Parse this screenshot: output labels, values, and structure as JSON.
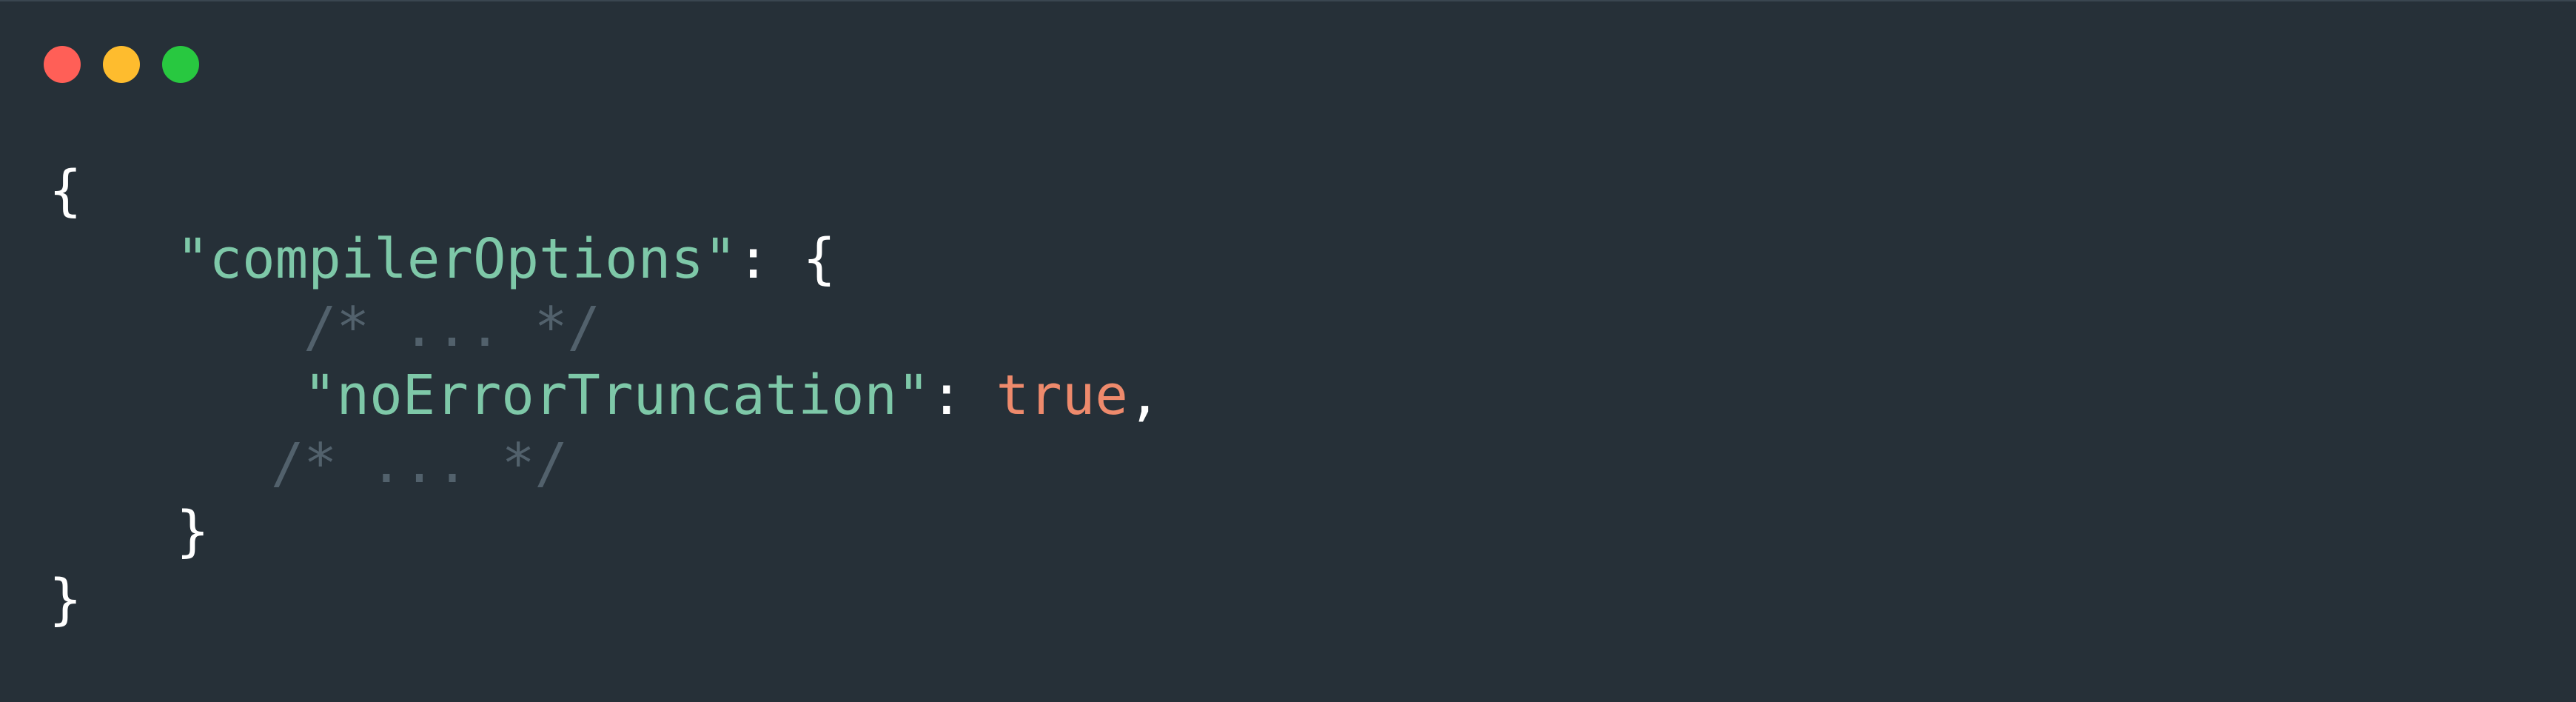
{
  "window": {
    "controls": [
      "close",
      "minimize",
      "maximize"
    ],
    "colors": {
      "background": "#263038",
      "close": "#ff5f57",
      "minimize": "#febc2e",
      "maximize": "#28c840",
      "key": "#7ec8a8",
      "boolean": "#ee8a6c",
      "comment": "#52616c",
      "punctuation": "#ffffff"
    }
  },
  "code": {
    "line1": {
      "open_brace": "{"
    },
    "line2": {
      "key": "\"compilerOptions\"",
      "colon": ":",
      "open_brace": "{"
    },
    "line3": {
      "comment": "/* ... */"
    },
    "line4": {
      "key": "\"noErrorTruncation\"",
      "colon": ":",
      "value": "true",
      "comma": ","
    },
    "line5": {
      "comment": "/* ... */"
    },
    "line6": {
      "close_brace": "}"
    },
    "line7": {
      "close_brace": "}"
    }
  }
}
